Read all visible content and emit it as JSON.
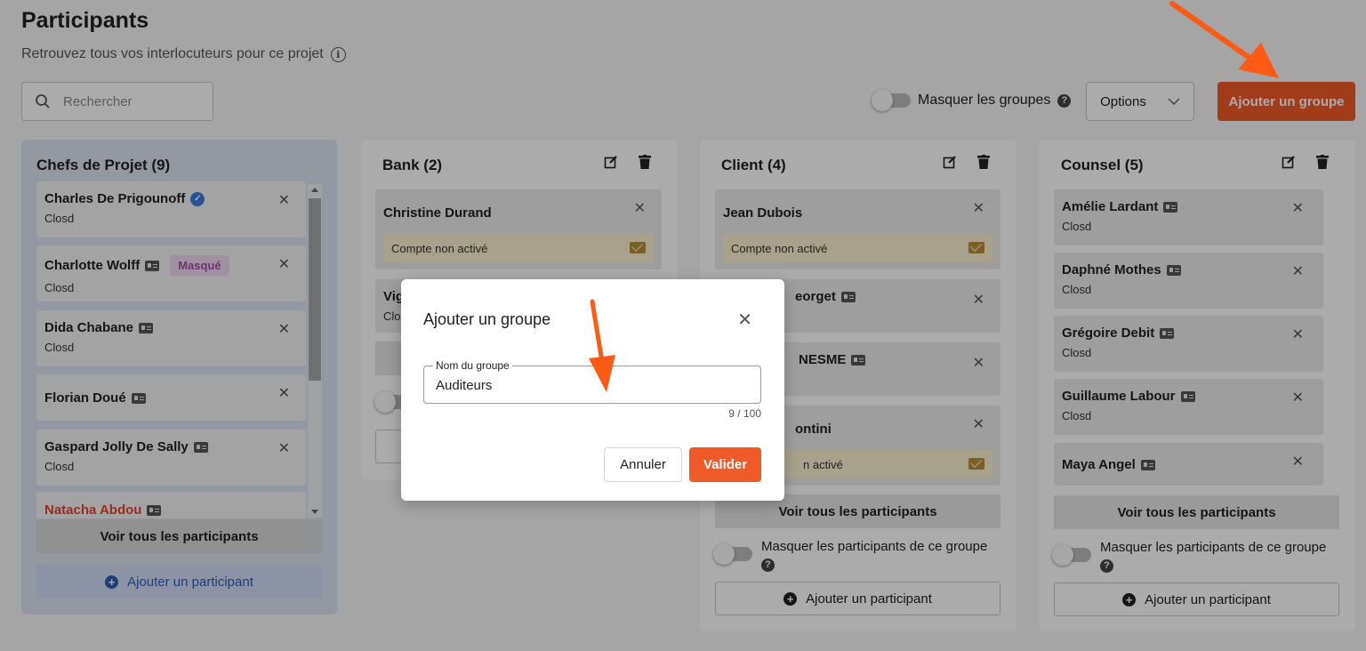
{
  "page": {
    "title": "Participants",
    "subtitle": "Retrouvez tous vos interlocuteurs pour ce projet",
    "search_placeholder": "Rechercher",
    "hide_groups_label": "Masquer les groupes",
    "options_label": "Options",
    "add_group_label": "Ajouter un groupe"
  },
  "groups": {
    "chefs": {
      "title": "Chefs de Projet (9)",
      "members": [
        {
          "name": "Charles De Prigounoff",
          "company": "Closd"
        },
        {
          "name": "Charlotte Wolff",
          "company": "Closd",
          "badge": "Masqué"
        },
        {
          "name": "Dida Chabane",
          "company": "Closd"
        },
        {
          "name": "Florian Doué",
          "company": ""
        },
        {
          "name": "Gaspard Jolly De Sally",
          "company": "Closd"
        },
        {
          "name": "Natacha Abdou",
          "company": ""
        }
      ],
      "see_all": "Voir tous les participants",
      "add_participant": "Ajouter un participant"
    },
    "bank": {
      "title": "Bank (2)",
      "members": [
        {
          "name": "Christine Durand",
          "status": "Compte non activé"
        },
        {
          "name": "Vig",
          "company": "Clo"
        }
      ]
    },
    "client": {
      "title": "Client (4)",
      "members": [
        {
          "name": "Jean Dubois",
          "status": "Compte non activé"
        },
        {
          "name": "eorget"
        },
        {
          "name": "NESME"
        },
        {
          "name": "ontini",
          "status": "n activé"
        }
      ],
      "see_all": "Voir tous les participants",
      "hide_participants": "Masquer les participants de ce groupe",
      "add_participant": "Ajouter un participant"
    },
    "counsel": {
      "title": "Counsel (5)",
      "members": [
        {
          "name": "Amélie Lardant",
          "company": "Closd"
        },
        {
          "name": "Daphné Mothes",
          "company": "Closd"
        },
        {
          "name": "Grégoire Debit",
          "company": "Closd"
        },
        {
          "name": "Guillaume Labour",
          "company": "Closd"
        },
        {
          "name": "Maya Angel",
          "company": ""
        }
      ],
      "see_all": "Voir tous les participants",
      "hide_participants": "Masquer les participants de ce groupe",
      "add_participant": "Ajouter un participant"
    }
  },
  "modal": {
    "title": "Ajouter un groupe",
    "field_label": "Nom du groupe",
    "field_value": "Auditeurs",
    "counter": "9 / 100",
    "cancel_label": "Annuler",
    "ok_label": "Valider"
  },
  "colors": {
    "accent": "#f05a28",
    "annotation_arrow": "#ff5a14",
    "inactive_bg": "#fbf0cf",
    "chefs_bg": "#dde4f0",
    "masque_badge": "#a64aa9",
    "natacha_name": "#e0442c"
  }
}
